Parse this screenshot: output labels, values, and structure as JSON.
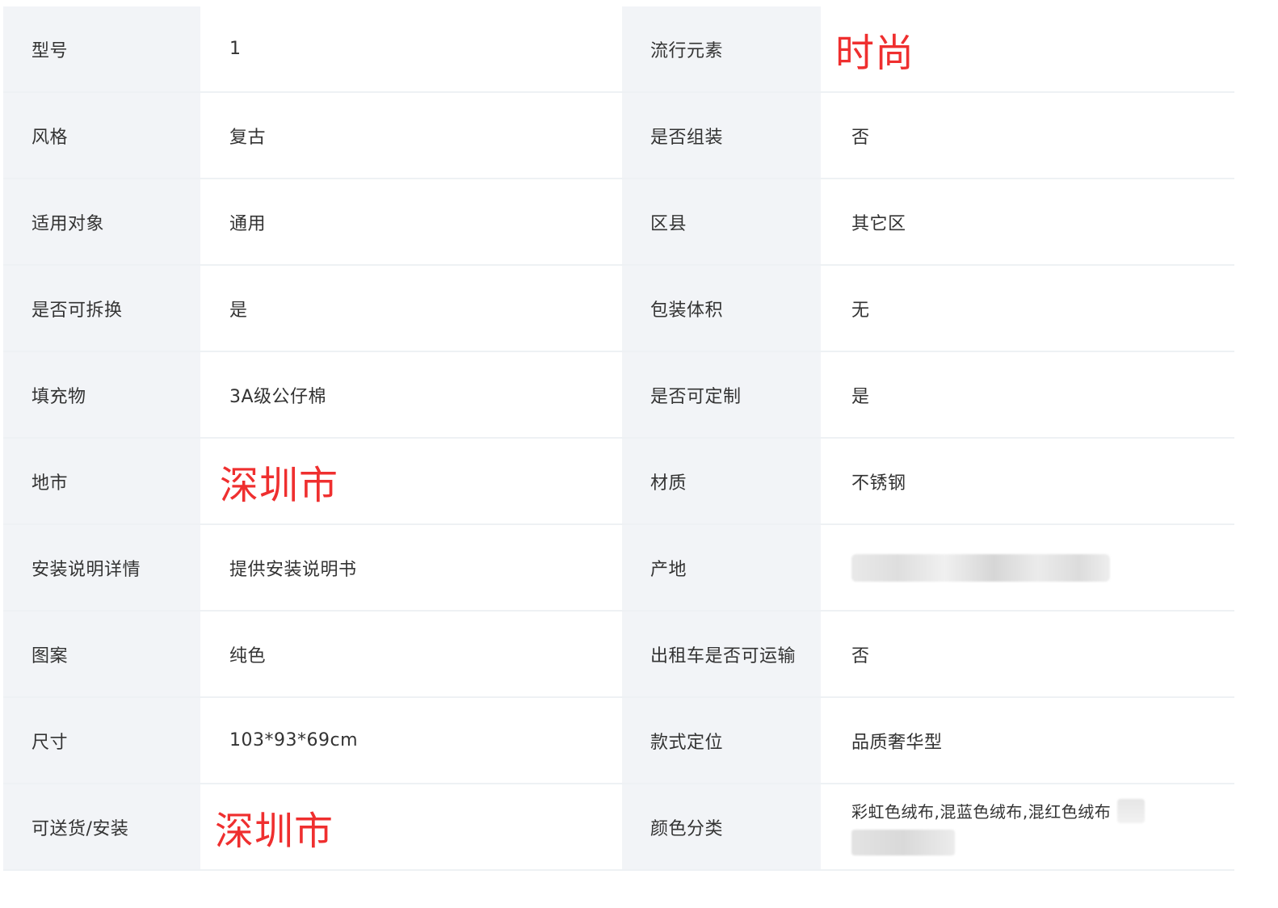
{
  "rows": [
    {
      "l1": "型号",
      "v1": "1",
      "l2": "流行元素",
      "v2": "时尚"
    },
    {
      "l1": "风格",
      "v1": "复古",
      "l2": "是否组装",
      "v2": "否"
    },
    {
      "l1": "适用对象",
      "v1": "通用",
      "l2": "区县",
      "v2": "其它区"
    },
    {
      "l1": "是否可拆换",
      "v1": "是",
      "l2": "包装体积",
      "v2": "无"
    },
    {
      "l1": "填充物",
      "v1": "3A级公仔棉",
      "l2": "是否可定制",
      "v2": "是"
    },
    {
      "l1": "地市",
      "v1": "深圳市",
      "l2": "材质",
      "v2": "不锈钢"
    },
    {
      "l1": "安装说明详情",
      "v1": "提供安装说明书",
      "l2": "产地",
      "v2": ""
    },
    {
      "l1": "图案",
      "v1": "纯色",
      "l2": "出租车是否可运输",
      "v2": "否"
    },
    {
      "l1": "尺寸",
      "v1": "103*93*69cm",
      "l2": "款式定位",
      "v2": "品质奢华型"
    },
    {
      "l1": "可送货/安装",
      "v1": "深圳市",
      "l2": "颜色分类",
      "v2": "彩虹色绒布,混蓝色绒布,混红色绒布"
    }
  ],
  "colors": {
    "label_bg": "#f2f4f7",
    "value_bg": "#ffffff",
    "text": "#333333",
    "highlight": "#ef2f2f"
  }
}
